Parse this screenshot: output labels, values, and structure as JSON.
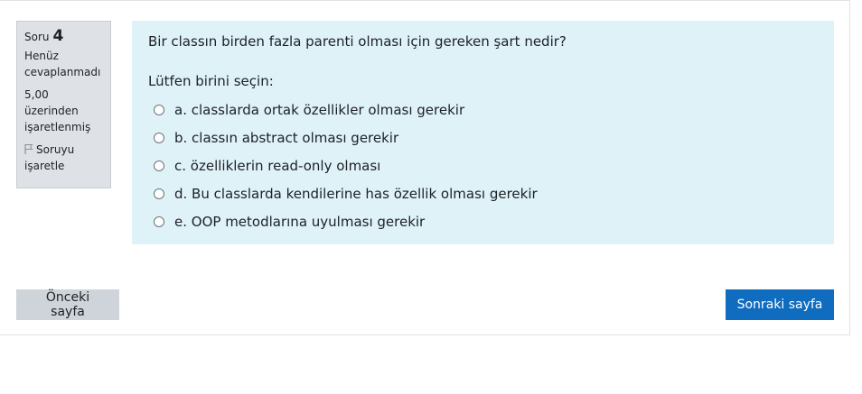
{
  "info": {
    "question_label": "Soru",
    "question_number": "4",
    "status_line1": "Henüz",
    "status_line2": "cevaplanmadı",
    "marks_line1": "5,00",
    "marks_line2": "üzerinden",
    "marks_line3": "işaretlenmiş",
    "flag_icon": "flag-outline-icon",
    "flag_line1": "Soruyu",
    "flag_line2": "işaretle"
  },
  "question": {
    "text": "Bir classın birden fazla parenti olması için gereken şart nedir?",
    "prompt": "Lütfen birini seçin:",
    "answers": [
      {
        "label": "a. classlarda ortak özellikler olması gerekir"
      },
      {
        "label": "b. classın abstract olması gerekir"
      },
      {
        "label": "c. özelliklerin read-only olması"
      },
      {
        "label": "d. Bu classlarda kendilerine has özellik olması gerekir"
      },
      {
        "label": "e. OOP metodlarına uyulması gerekir"
      }
    ]
  },
  "navigation": {
    "prev_label": "Önceki sayfa",
    "next_label": "Sonraki sayfa"
  },
  "colors": {
    "content_background": "#def2f8",
    "info_background": "#dee2e6",
    "primary_button": "#0f6cbf",
    "secondary_button": "#ced4da"
  }
}
